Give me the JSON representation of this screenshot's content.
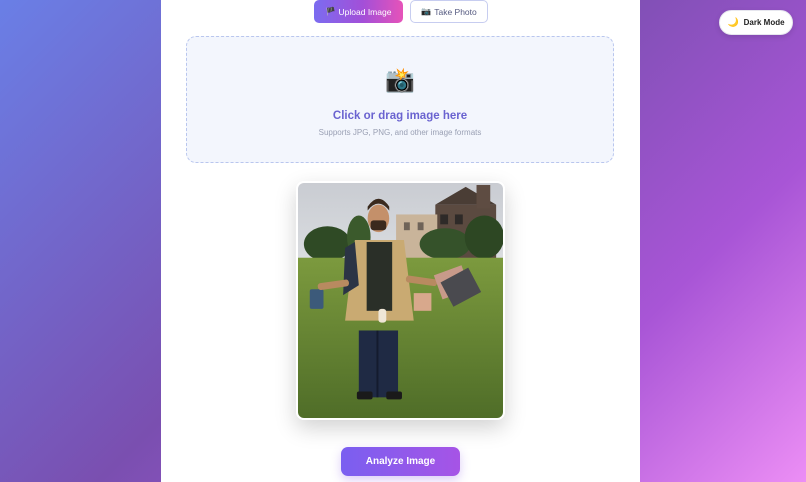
{
  "theme_toggle": {
    "icon": "🌙",
    "label": "Dark Mode"
  },
  "tabs": [
    {
      "icon": "🏴",
      "label": "Upload Image",
      "active": true
    },
    {
      "icon": "📷",
      "label": "Take Photo",
      "active": false
    }
  ],
  "dropzone": {
    "icon": "📸",
    "title": "Click or drag image here",
    "subtitle": "Supports JPG, PNG, and other image formats"
  },
  "preview": {
    "image": "photo-man-in-park"
  },
  "actions": {
    "analyze_label": "Analyze Image"
  },
  "colors": {
    "accent": "#7a5ff0",
    "accent_pink": "#e653b9",
    "dropzone_border": "#b9c6ee",
    "dropzone_bg": "#f3f6fd"
  }
}
